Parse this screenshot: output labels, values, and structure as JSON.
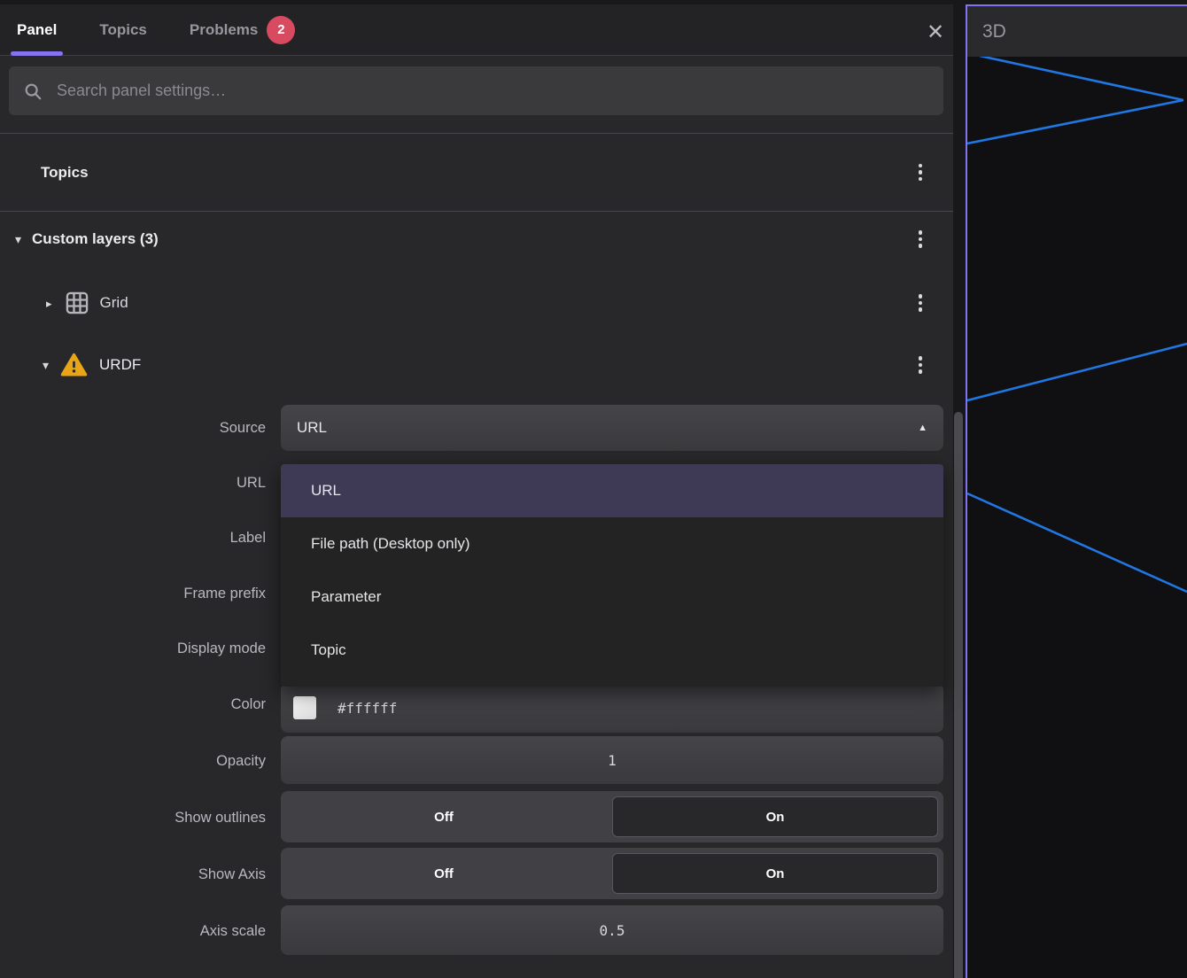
{
  "tabs": {
    "panel": "Panel",
    "topics": "Topics",
    "problems": "Problems",
    "problems_count": "2"
  },
  "icons": {
    "close": "✕",
    "caret_down": "▾",
    "caret_right": "▸",
    "caret_up": "▲"
  },
  "search": {
    "placeholder": "Search panel settings…"
  },
  "sections": {
    "topics_title": "Topics",
    "custom_layers_title": "Custom layers (3)"
  },
  "layers": {
    "grid_label": "Grid",
    "urdf_label": "URDF"
  },
  "settings": {
    "source": {
      "label": "Source",
      "value": "URL"
    },
    "url": {
      "label": "URL"
    },
    "label_field": {
      "label": "Label"
    },
    "frame_prefix": {
      "label": "Frame prefix"
    },
    "display_mode": {
      "label": "Display mode"
    },
    "color": {
      "label": "Color",
      "value": "#ffffff",
      "swatch": "#ffffff"
    },
    "opacity": {
      "label": "Opacity",
      "value": "1"
    },
    "show_outlines": {
      "label": "Show outlines",
      "off": "Off",
      "on": "On",
      "selected": "On"
    },
    "show_axis": {
      "label": "Show Axis",
      "off": "Off",
      "on": "On",
      "selected": "On"
    },
    "axis_scale": {
      "label": "Axis scale",
      "value": "0.5"
    }
  },
  "dropdown": {
    "selected": "URL",
    "options": [
      "URL",
      "File path (Desktop only)",
      "Parameter",
      "Topic"
    ]
  },
  "panel_3d": {
    "title": "3D"
  },
  "colors": {
    "accent_purple": "#8273f3",
    "tab_underline": "#8573f0",
    "badge_red": "#d84a60",
    "warning_amber": "#eaa517",
    "line_blue": "#2077e4",
    "color_swatch": "#ffffff"
  }
}
